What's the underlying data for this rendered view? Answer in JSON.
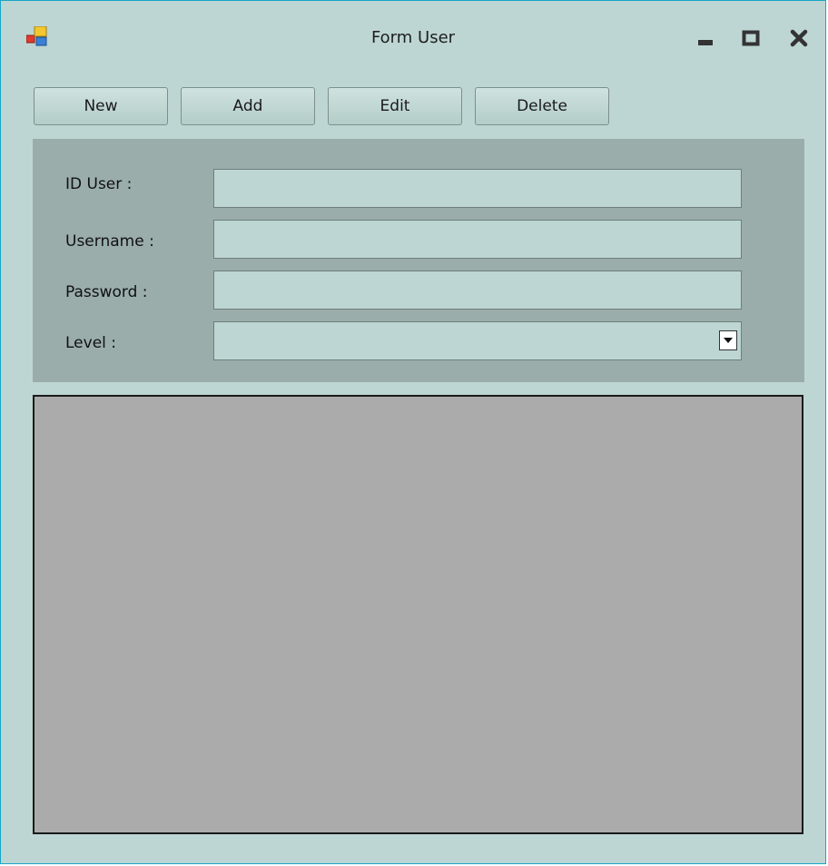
{
  "window": {
    "title": "Form User",
    "app_icon": "winforms-app-icon",
    "controls": {
      "minimize_icon": "minimize-icon",
      "maximize_icon": "maximize-icon",
      "close_icon": "close-icon"
    }
  },
  "toolbar": {
    "new_label": "New",
    "add_label": "Add",
    "edit_label": "Edit",
    "delete_label": "Delete"
  },
  "form": {
    "id_user": {
      "label": "ID User :",
      "value": ""
    },
    "username": {
      "label": "Username :",
      "value": ""
    },
    "password": {
      "label": "Password :",
      "value": ""
    },
    "level": {
      "label": "Level :",
      "value": ""
    }
  },
  "data_grid": {
    "rows": []
  },
  "colors": {
    "window_background": "#bdd6d3",
    "panel_background": "#9aadaa",
    "grid_background": "#ababab",
    "window_border": "#17a6c8"
  }
}
